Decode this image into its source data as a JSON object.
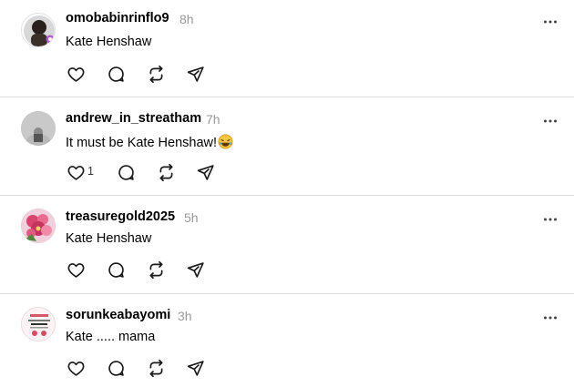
{
  "replies": [
    {
      "username": "omobabinrinflo9",
      "time": "8h",
      "text": "Kate Henshaw",
      "likes": ""
    },
    {
      "username": "andrew_in_streatham",
      "time": "7h",
      "text": "It must be Kate Henshaw!",
      "emoji": "face-with-tears-of-joy",
      "likes": "1"
    },
    {
      "username": "treasuregold2025",
      "time": "5h",
      "text": "Kate Henshaw",
      "likes": ""
    },
    {
      "username": "sorunkeabayomi",
      "time": "3h",
      "text": "Kate ..... mama",
      "likes": ""
    }
  ],
  "icons": {
    "like": "heart-icon",
    "comment": "comment-icon",
    "repost": "repost-icon",
    "share": "share-icon",
    "more": "more-icon"
  },
  "colors": {
    "time": "#999999",
    "divider": "#dedede",
    "icon": "#1a1a1a"
  }
}
